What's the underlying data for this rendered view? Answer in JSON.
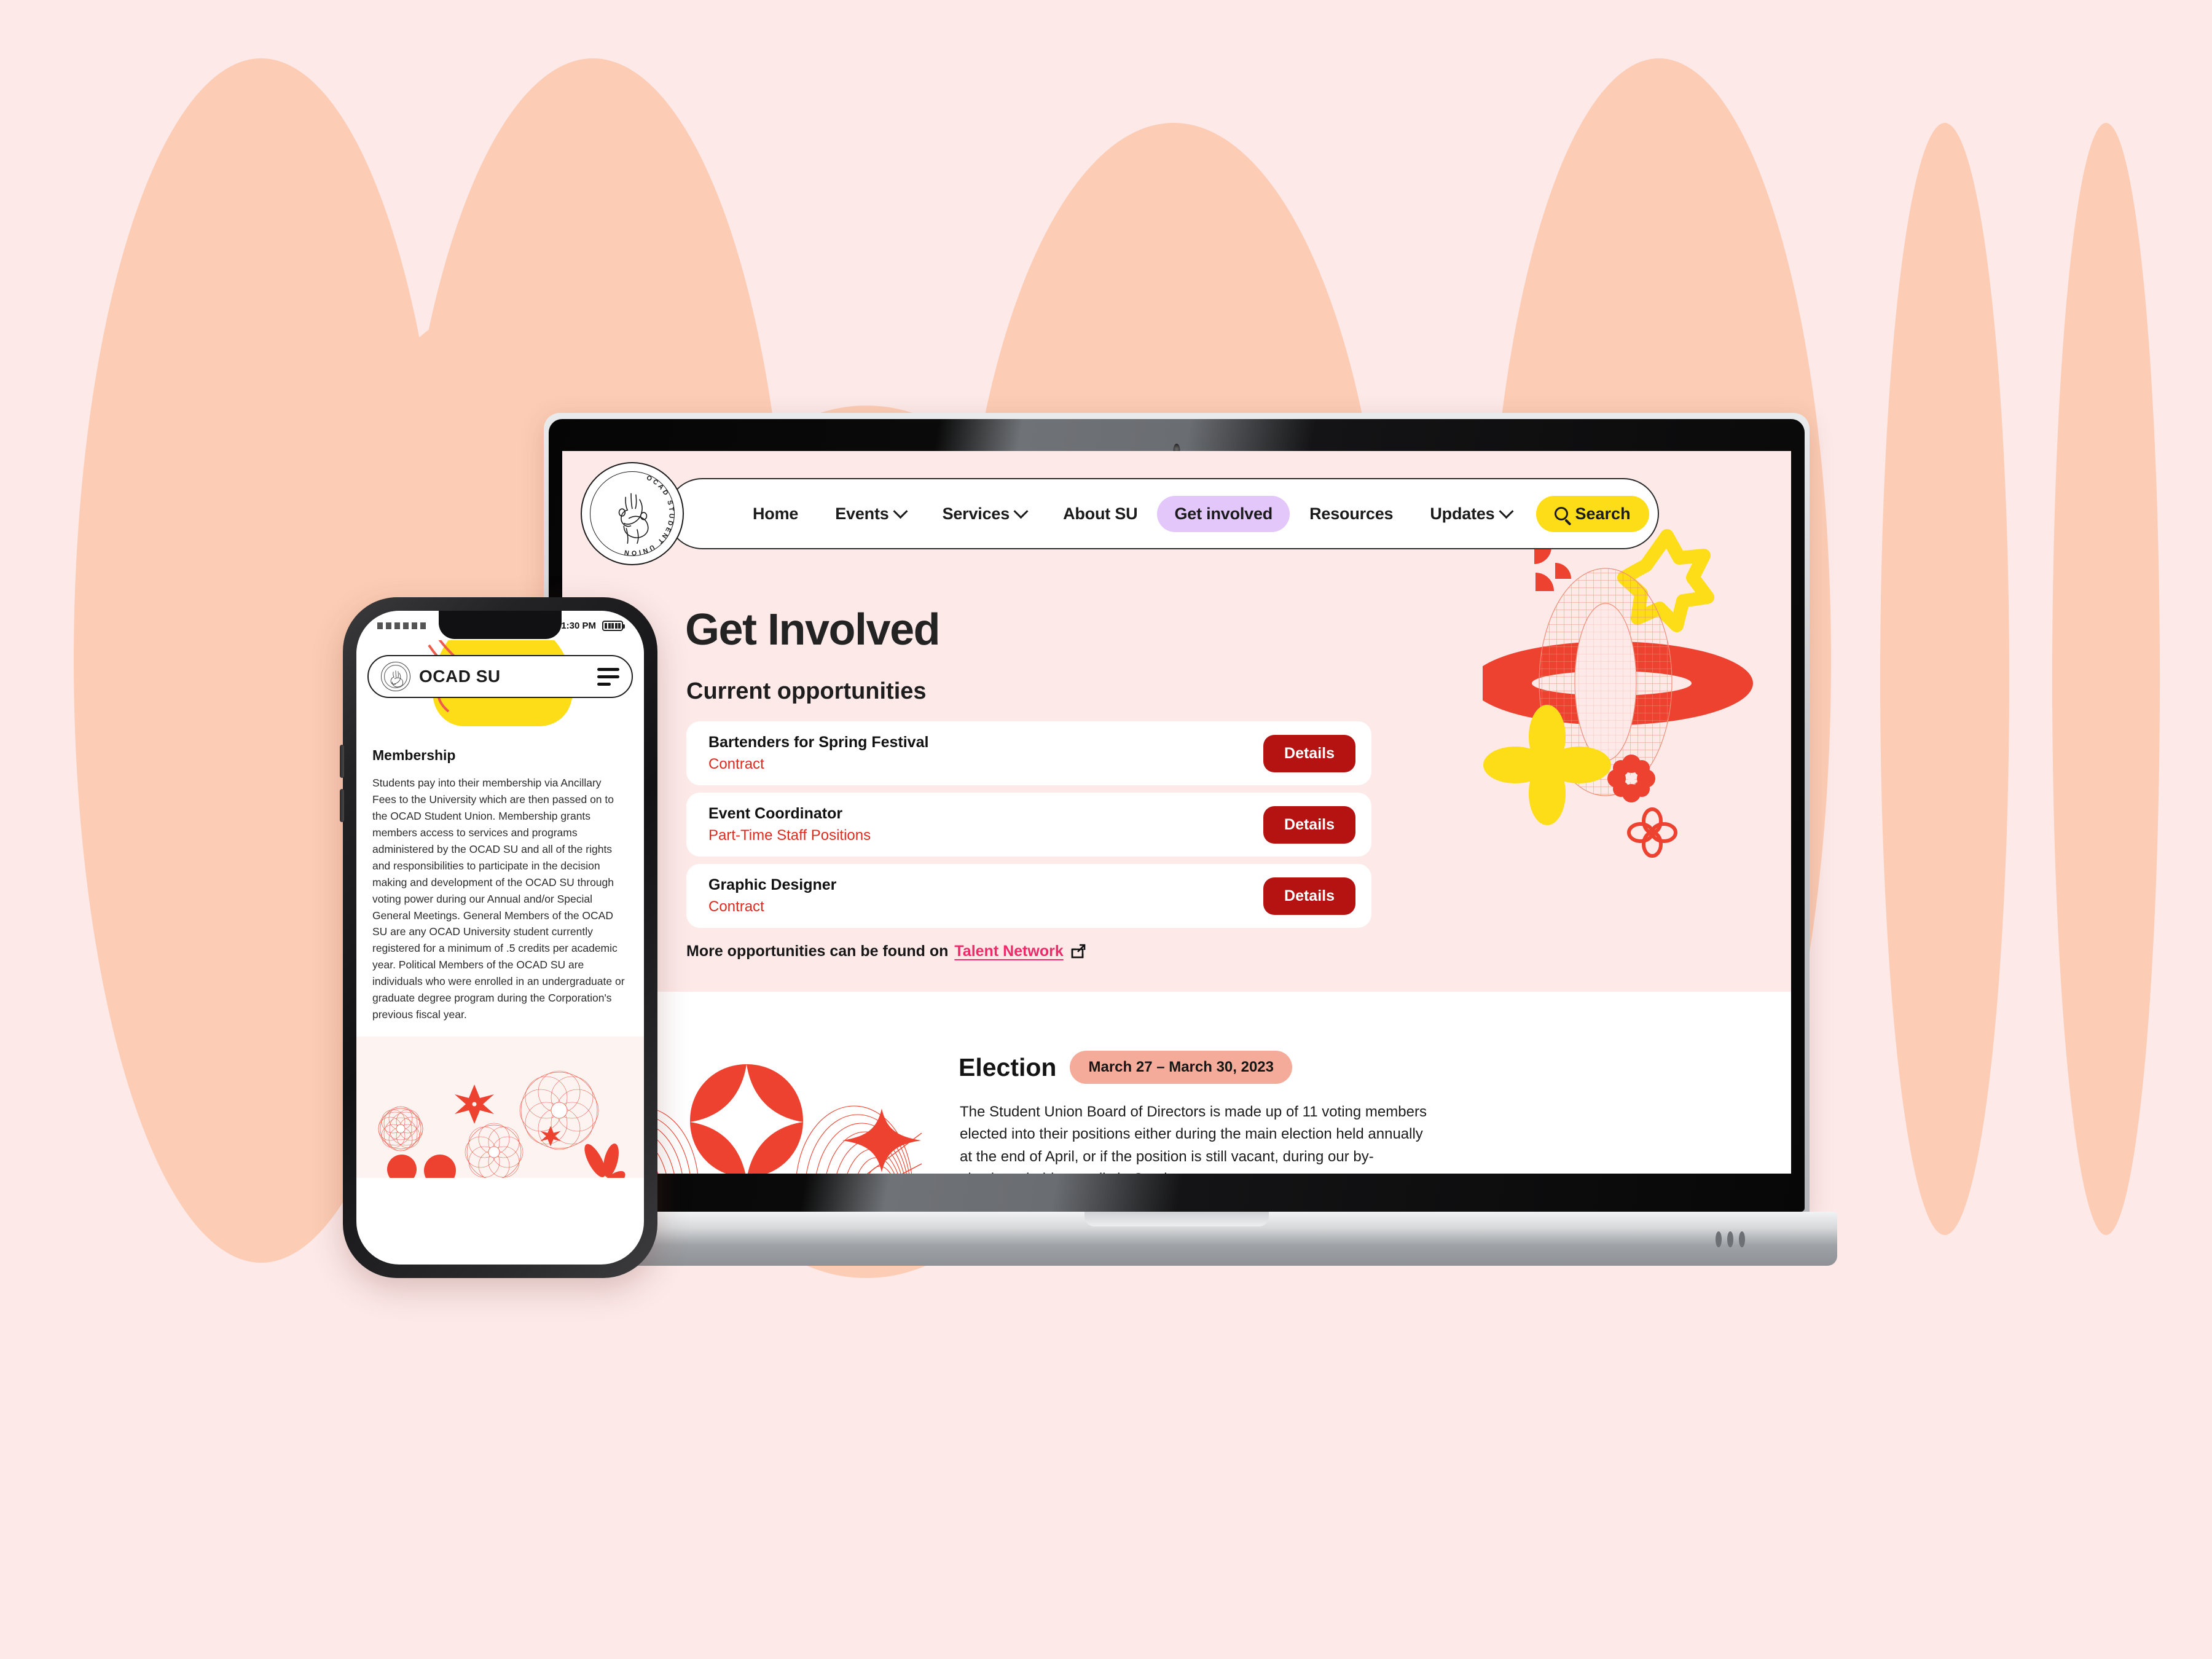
{
  "colors": {
    "background": "#fce9e8",
    "background_ellipse": "#fcccb4",
    "page_bg": "#fce9e8",
    "accent_red": "#ee4230",
    "details_red": "#b51212",
    "subtitle_red": "#e12a1d",
    "link_pink": "#ee2a6a",
    "yellow": "#fcdd17",
    "lavender": "#e3c7fb",
    "date_pill": "#f5ab99",
    "white": "#ffffff",
    "text_dark": "#1b1b1b"
  },
  "laptop": {
    "device_name": "laptop-mockup",
    "site": {
      "logo": {
        "seal_text": "OCAD STUDENT UNION",
        "icon": "anatomical-heart-icon"
      },
      "nav": {
        "items": [
          {
            "label": "Home",
            "has_dropdown": false,
            "active": false
          },
          {
            "label": "Events",
            "has_dropdown": true,
            "active": false
          },
          {
            "label": "Services",
            "has_dropdown": true,
            "active": false
          },
          {
            "label": "About SU",
            "has_dropdown": false,
            "active": false
          },
          {
            "label": "Get involved",
            "has_dropdown": false,
            "active": true
          },
          {
            "label": "Resources",
            "has_dropdown": false,
            "active": false
          },
          {
            "label": "Updates",
            "has_dropdown": true,
            "active": false
          }
        ],
        "search_label": "Search",
        "search_icon": "search-icon"
      },
      "hero": {
        "title": "Get Involved",
        "subtitle": "Current opportunities"
      },
      "opportunities": [
        {
          "title": "Bartenders for Spring Festival",
          "type": "Contract",
          "button": "Details"
        },
        {
          "title": "Event Coordinator",
          "type": "Part-Time Staff Positions",
          "button": "Details"
        },
        {
          "title": "Graphic Designer",
          "type": "Contract",
          "button": "Details"
        }
      ],
      "more_opportunities": {
        "prefix": "More opportunities can be found on",
        "link_label": "Talent Network",
        "icon": "external-link-icon"
      },
      "election": {
        "heading": "Election",
        "date_badge": "March 27 – March 30, 2023",
        "body": "The Student Union Board of Directors is made up of 11 voting members elected into their positions either during the main election held annually at the end of April, or if the position is still vacant, during our by-elections, held annually in October."
      }
    }
  },
  "phone": {
    "device_name": "phone-mockup",
    "status_bar": {
      "time": "1:30 PM",
      "signal": "signal-bars-icon",
      "battery": "battery-icon"
    },
    "nav": {
      "brand": "OCAD SU",
      "logo_icon": "ocad-seal-icon",
      "menu_icon": "hamburger-menu-icon"
    },
    "content": {
      "heading": "Membership",
      "body": "Students pay into their membership via Ancillary Fees to the University which are then passed on to the OCAD Student Union. Membership grants members access to services and programs administered by the OCAD SU and all of the rights and responsibilities to participate in the decision making and development of the OCAD SU through voting power during our Annual and/or Special General Meetings. General Members of the OCAD SU are any OCAD University student currently registered for a minimum of .5 credits per academic year. Political Members of the OCAD SU are individuals who were enrolled in an undergraduate or graduate degree program during the Corporation's previous fiscal year."
    }
  }
}
